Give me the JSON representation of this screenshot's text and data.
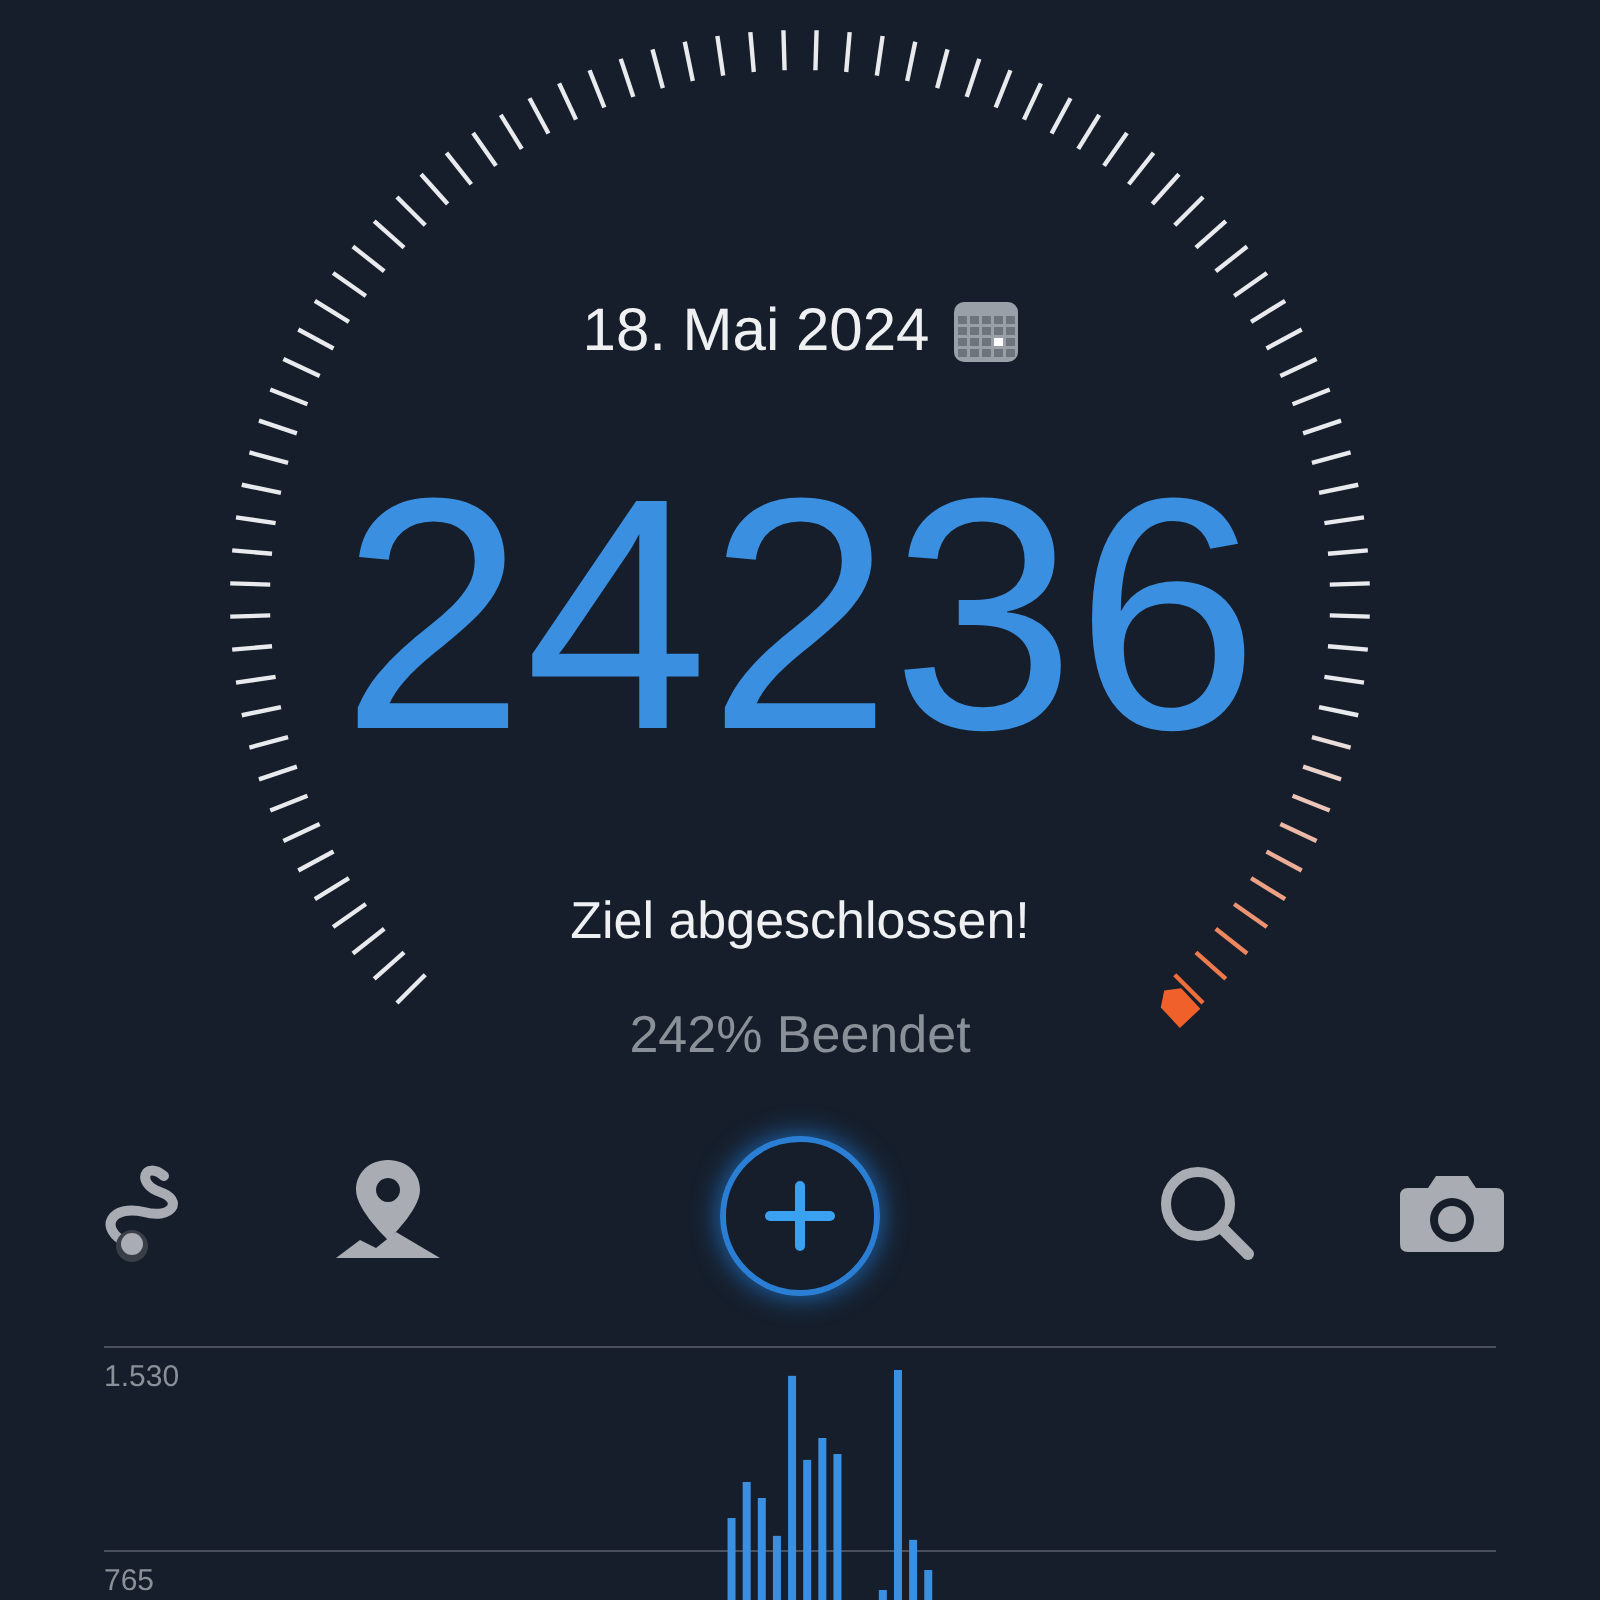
{
  "date": "18. Mai 2024",
  "steps": "24236",
  "goal_message": "Ziel abgeschlossen!",
  "progress_text": "242% Beendet",
  "toolbar": [
    {
      "kind": "route"
    },
    {
      "kind": "map"
    },
    {
      "kind": "add"
    },
    {
      "kind": "search"
    },
    {
      "kind": "camera"
    }
  ],
  "chart_data": {
    "type": "bar",
    "ylim": [
      0,
      1530
    ],
    "yticks": [
      {
        "value": 765,
        "label": "765"
      },
      {
        "value": 1530,
        "label": "1.530"
      }
    ],
    "values": [
      0,
      0,
      0,
      0,
      0,
      0,
      0,
      0,
      0,
      0,
      0,
      0,
      0,
      0,
      0,
      0,
      0,
      0,
      0,
      0,
      0,
      0,
      0,
      0,
      0,
      0,
      0,
      0,
      0,
      0,
      0,
      0,
      0,
      0,
      0,
      0,
      0,
      0,
      0,
      0,
      0,
      885,
      1020,
      960,
      818,
      1418,
      1103,
      1185,
      1125,
      0,
      0,
      615,
      1440,
      803,
      690,
      0,
      0,
      0,
      0,
      0,
      0,
      0,
      0,
      0,
      0,
      0,
      0,
      0,
      0,
      0,
      0,
      0,
      0,
      0,
      0,
      0,
      0,
      0,
      0,
      0,
      0,
      0,
      0,
      0,
      0,
      0,
      0,
      0,
      0,
      0,
      0,
      0
    ]
  }
}
